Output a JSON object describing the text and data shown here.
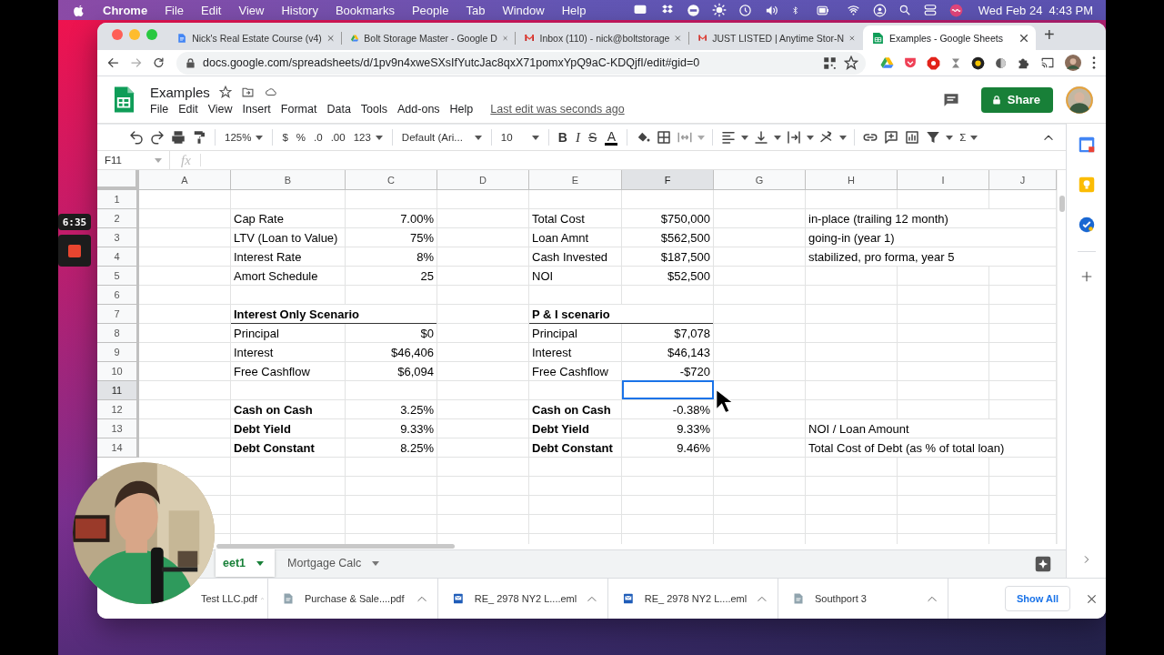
{
  "menubar": {
    "app": "Chrome",
    "items": [
      "File",
      "Edit",
      "View",
      "History",
      "Bookmarks",
      "People",
      "Tab",
      "Window",
      "Help"
    ],
    "clock": "Wed Feb 24  4:43 PM"
  },
  "recorder": {
    "time": "6:35"
  },
  "browser": {
    "tabs": [
      {
        "title": "Nick's Real Estate Course (v4)",
        "kind": "docs",
        "selected": false
      },
      {
        "title": "Bolt Storage Master - Google D",
        "kind": "drive",
        "selected": false
      },
      {
        "title": "Inbox (110) - nick@boltstorage",
        "kind": "gmail",
        "selected": false
      },
      {
        "title": "JUST LISTED | Anytime Stor-N",
        "kind": "gmail",
        "selected": false
      },
      {
        "title": "Examples - Google Sheets",
        "kind": "sheets",
        "selected": true
      }
    ],
    "new_tab": "+",
    "url": "docs.google.com/spreadsheets/d/1pv9n4xweSXsIfYutcJac8qxX71pomxYpQ9aC-KDQjfI/edit#gid=0"
  },
  "doc": {
    "title": "Examples",
    "menu": [
      "File",
      "Edit",
      "View",
      "Insert",
      "Format",
      "Data",
      "Tools",
      "Add-ons",
      "Help"
    ],
    "last_edit": "Last edit was seconds ago",
    "share": "Share"
  },
  "toolbar": {
    "zoom": "125%",
    "currency": "$",
    "percent": "%",
    "decrease_decimals": ".0",
    "increase_decimals": ".00",
    "number_format": "123",
    "font": "Default (Ari...",
    "font_size": "10",
    "bold": "B",
    "italic": "I",
    "strikethrough": "S",
    "text_color": "A",
    "functions": "Σ"
  },
  "formula_bar": {
    "cell": "F11",
    "fx": "fx"
  },
  "sheet": {
    "columns": [
      {
        "label": "A",
        "selected": false
      },
      {
        "label": "B",
        "selected": false
      },
      {
        "label": "C",
        "selected": false
      },
      {
        "label": "D",
        "selected": false
      },
      {
        "label": "E",
        "selected": false
      },
      {
        "label": "F",
        "selected": true
      },
      {
        "label": "G",
        "selected": false
      },
      {
        "label": "H",
        "selected": false
      },
      {
        "label": "I",
        "selected": false
      },
      {
        "label": "J",
        "selected": false
      }
    ],
    "rows": [
      {
        "number": "1",
        "selected": false
      },
      {
        "number": "2",
        "selected": false,
        "cells": {
          "B": {
            "text": "Cap Rate",
            "kind": "text",
            "bold": false
          },
          "C": {
            "text": "7.00%",
            "kind": "number",
            "bold": false
          },
          "E": {
            "text": "Total Cost",
            "kind": "text",
            "bold": false
          },
          "F": {
            "text": "$750,000",
            "kind": "number",
            "bold": false
          },
          "H": {
            "text": "in-place (trailing 12 month)",
            "kind": "text",
            "bold": false
          }
        }
      },
      {
        "number": "3",
        "selected": false,
        "cells": {
          "B": {
            "text": "LTV (Loan to Value)",
            "kind": "text",
            "bold": false
          },
          "C": {
            "text": "75%",
            "kind": "number",
            "bold": false
          },
          "E": {
            "text": "Loan Amnt",
            "kind": "text",
            "bold": false
          },
          "F": {
            "text": "$562,500",
            "kind": "number",
            "bold": false
          },
          "H": {
            "text": "going-in (year 1)",
            "kind": "text",
            "bold": false
          }
        }
      },
      {
        "number": "4",
        "selected": false,
        "cells": {
          "B": {
            "text": "Interest Rate",
            "kind": "text",
            "bold": false
          },
          "C": {
            "text": "8%",
            "kind": "number",
            "bold": false
          },
          "E": {
            "text": "Cash Invested",
            "kind": "text",
            "bold": false
          },
          "F": {
            "text": "$187,500",
            "kind": "number",
            "bold": false
          },
          "H": {
            "text": "stabilized, pro forma, year 5",
            "kind": "text",
            "bold": false
          }
        }
      },
      {
        "number": "5",
        "selected": false,
        "cells": {
          "B": {
            "text": "Amort Schedule",
            "kind": "text",
            "bold": false
          },
          "C": {
            "text": "25",
            "kind": "number",
            "bold": false
          },
          "E": {
            "text": "NOI",
            "kind": "text",
            "bold": false
          },
          "F": {
            "text": "$52,500",
            "kind": "number",
            "bold": false
          }
        }
      },
      {
        "number": "6",
        "selected": false
      },
      {
        "number": "7",
        "selected": false,
        "cells": {
          "B": {
            "text": "Interest Only Scenario",
            "kind": "heading",
            "bold": true
          },
          "E": {
            "text": "P & I scenario",
            "kind": "heading",
            "bold": true
          }
        }
      },
      {
        "number": "8",
        "selected": false,
        "cells": {
          "B": {
            "text": "Principal",
            "kind": "text",
            "bold": false
          },
          "C": {
            "text": "$0",
            "kind": "number",
            "bold": false
          },
          "E": {
            "text": "Principal",
            "kind": "text",
            "bold": false
          },
          "F": {
            "text": "$7,078",
            "kind": "number",
            "bold": false
          }
        }
      },
      {
        "number": "9",
        "selected": false,
        "cells": {
          "B": {
            "text": "Interest",
            "kind": "text",
            "bold": false
          },
          "C": {
            "text": "$46,406",
            "kind": "number",
            "bold": false
          },
          "E": {
            "text": "Interest",
            "kind": "text",
            "bold": false
          },
          "F": {
            "text": "$46,143",
            "kind": "number",
            "bold": false
          }
        }
      },
      {
        "number": "10",
        "selected": false,
        "cells": {
          "B": {
            "text": "Free Cashflow",
            "kind": "text",
            "bold": false
          },
          "C": {
            "text": "$6,094",
            "kind": "number",
            "bold": false
          },
          "E": {
            "text": "Free Cashflow",
            "kind": "text",
            "bold": false
          },
          "F": {
            "text": "-$720",
            "kind": "number",
            "bold": false
          }
        }
      },
      {
        "number": "11",
        "selected": true
      },
      {
        "number": "12",
        "selected": false,
        "cells": {
          "B": {
            "text": "Cash on Cash",
            "kind": "text",
            "bold": true
          },
          "C": {
            "text": "3.25%",
            "kind": "number",
            "bold": false
          },
          "E": {
            "text": "Cash on Cash",
            "kind": "text",
            "bold": true
          },
          "F": {
            "text": "-0.38%",
            "kind": "number",
            "bold": false
          }
        }
      },
      {
        "number": "13",
        "selected": false,
        "cells": {
          "B": {
            "text": "Debt Yield",
            "kind": "text",
            "bold": true
          },
          "C": {
            "text": "9.33%",
            "kind": "number",
            "bold": false
          },
          "E": {
            "text": "Debt Yield",
            "kind": "text",
            "bold": true
          },
          "F": {
            "text": "9.33%",
            "kind": "number",
            "bold": false
          },
          "H": {
            "text": "NOI / Loan Amount",
            "kind": "text",
            "bold": false
          }
        }
      },
      {
        "number": "14",
        "selected": false,
        "cells": {
          "B": {
            "text": "Debt Constant",
            "kind": "text",
            "bold": true
          },
          "C": {
            "text": "8.25%",
            "kind": "number",
            "bold": false
          },
          "E": {
            "text": "Debt Constant",
            "kind": "text",
            "bold": true
          },
          "F": {
            "text": "9.46%",
            "kind": "number",
            "bold": false
          },
          "H": {
            "text": "Total Cost of Debt (as % of total loan)",
            "kind": "text",
            "bold": false
          }
        }
      }
    ]
  },
  "sheet_tabs": [
    {
      "label": "eet1",
      "selected": true
    },
    {
      "label": "Mortgage Calc",
      "selected": false
    }
  ],
  "downloads": {
    "items": [
      {
        "name": "Test LLC.pdf"
      },
      {
        "name": "Purchase & Sale....pdf",
        "kind": "pdf"
      },
      {
        "name": "RE_ 2978 NY2 L....eml",
        "kind": "mail"
      },
      {
        "name": "RE_ 2978 NY2 L....eml",
        "kind": "mail"
      },
      {
        "name": "Southport 3",
        "kind": "pdf"
      }
    ],
    "show_all": "Show All"
  }
}
